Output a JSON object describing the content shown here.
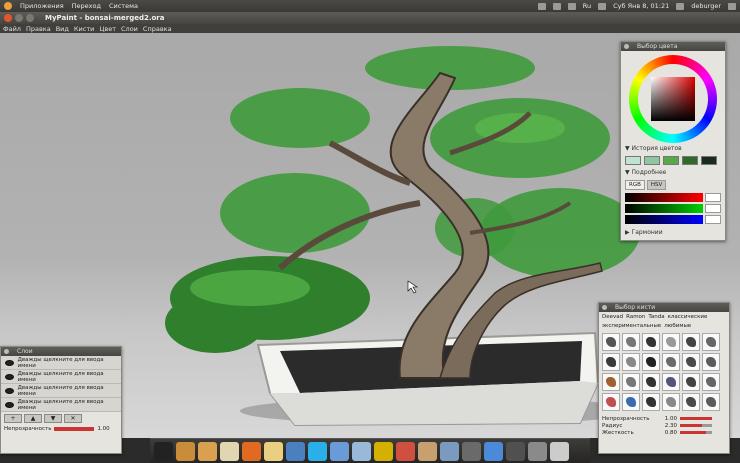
{
  "top_panel": {
    "menu": [
      "Приложения",
      "Переход",
      "Система"
    ],
    "tray": {
      "lang": "Ru",
      "datetime": "Суб Янв 8, 01:21",
      "user": "deburger"
    }
  },
  "window": {
    "title": "MyPaint - bonsai-merged2.ora"
  },
  "menu_bar": [
    "Файл",
    "Правка",
    "Вид",
    "Кисти",
    "Цвет",
    "Слои",
    "Справка"
  ],
  "color_panel": {
    "title": "Выбор цвета",
    "history_label": "История цветов",
    "history_colors": [
      "#bfe3cf",
      "#8fc6a0",
      "#58a84a",
      "#2f6a2a",
      "#1a2a1e"
    ],
    "details_label": "Подробнее",
    "tabs": [
      "RGB",
      "HSV"
    ],
    "active_tab": "HSV",
    "harmony_label": "Гармонии"
  },
  "layers_panel": {
    "title": "Слои",
    "layers": [
      "Дважды щелкните для ввода имени",
      "Дважды щелкните для ввода имени",
      "Дважды щелкните для ввода имени",
      "Дважды щелкните для ввода имени"
    ],
    "buttons": [
      "+",
      "▲",
      "▼",
      "✕"
    ],
    "opacity_label": "Непрозрачность",
    "opacity_value": "1.00",
    "opacity_fraction": 1.0
  },
  "brush_panel": {
    "title": "Выбор кисти",
    "tabs": [
      "Deevad",
      "Ramon",
      "Tanda",
      "классические",
      "экспериментальные",
      "любимые"
    ],
    "settings": [
      {
        "label": "Непрозрачность",
        "value": "1.00",
        "fraction": 1.0
      },
      {
        "label": "Радиус",
        "value": "2.30",
        "fraction": 0.7
      },
      {
        "label": "Жесткость",
        "value": "0.80",
        "fraction": 0.8
      }
    ],
    "brush_colors": [
      "#555",
      "#777",
      "#333",
      "#999",
      "#444",
      "#666",
      "#3a3a3a",
      "#888",
      "#222",
      "#6a6a6a",
      "#4a4a4a",
      "#5c5c5c",
      "#a06030",
      "#777",
      "#333",
      "#557",
      "#444",
      "#666",
      "#c05050",
      "#3c6ab0",
      "#333",
      "#888",
      "#4a4a4a",
      "#5c5c5c"
    ]
  },
  "dock": {
    "icons": [
      {
        "name": "terminal-icon",
        "color": "#222"
      },
      {
        "name": "home-folder-icon",
        "color": "#c98c3a"
      },
      {
        "name": "files-icon",
        "color": "#d9a050"
      },
      {
        "name": "text-editor-icon",
        "color": "#e0d7b0"
      },
      {
        "name": "firefox-icon",
        "color": "#e06b20"
      },
      {
        "name": "notes-icon",
        "color": "#e8d080"
      },
      {
        "name": "thunderbird-icon",
        "color": "#4a80c0"
      },
      {
        "name": "skype-icon",
        "color": "#2ab0e8"
      },
      {
        "name": "download-icon",
        "color": "#6a9ad8"
      },
      {
        "name": "install-icon",
        "color": "#9ab8d8"
      },
      {
        "name": "power-icon",
        "color": "#d4b000"
      },
      {
        "name": "chrome-icon",
        "color": "#d05040"
      },
      {
        "name": "mypaint-icon",
        "color": "#c8a070"
      },
      {
        "name": "image-viewer-icon",
        "color": "#7a9ac0"
      },
      {
        "name": "monitor-icon",
        "color": "#6a6a6a"
      },
      {
        "name": "desktop-icon",
        "color": "#4a8ad8"
      },
      {
        "name": "workspaces-icon",
        "color": "#505050"
      },
      {
        "name": "settings-icon",
        "color": "#8a8a8a"
      },
      {
        "name": "trash-icon",
        "color": "#cccccc"
      }
    ]
  }
}
